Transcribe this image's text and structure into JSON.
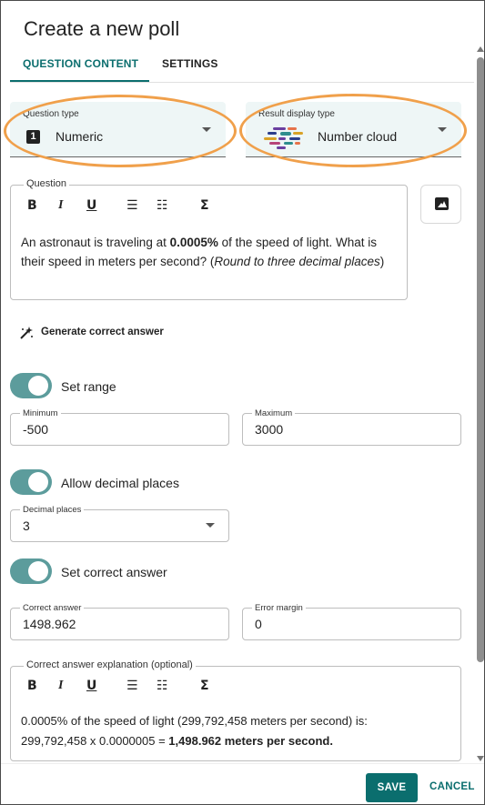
{
  "dialog": {
    "title": "Create a new poll"
  },
  "tabs": [
    {
      "label": "QUESTION CONTENT",
      "active": true
    },
    {
      "label": "SETTINGS",
      "active": false
    }
  ],
  "question_type": {
    "label": "Question type",
    "value": "Numeric",
    "icon": "number-1-icon"
  },
  "result_display": {
    "label": "Result display type",
    "value": "Number cloud",
    "icon": "number-cloud-icon"
  },
  "question": {
    "label": "Question",
    "toolbar": [
      "bold",
      "italic",
      "underline",
      "bulleted-list",
      "numbered-list",
      "equation"
    ],
    "text_pre": "An astronaut is traveling at ",
    "text_bold": "0.0005%",
    "text_mid": " of the speed of light. What is their speed in meters per second? (",
    "text_italic": "Round to three decimal places",
    "text_post": ")"
  },
  "generate_answer": {
    "label": "Generate correct answer"
  },
  "set_range": {
    "label": "Set range",
    "enabled": true
  },
  "minimum": {
    "label": "Minimum",
    "value": "-500"
  },
  "maximum": {
    "label": "Maximum",
    "value": "3000"
  },
  "allow_decimal": {
    "label": "Allow decimal places",
    "enabled": true
  },
  "decimal_places": {
    "label": "Decimal places",
    "value": "3"
  },
  "set_correct": {
    "label": "Set correct answer",
    "enabled": true
  },
  "correct_answer": {
    "label": "Correct answer",
    "value": "1498.962"
  },
  "error_margin": {
    "label": "Error margin",
    "value": "0"
  },
  "explanation": {
    "label": "Correct answer explanation (optional)",
    "line1": "0.0005% of the speed of light (299,792,458 meters per second) is:",
    "line2_pre": "299,792,458 x 0.0000005 = ",
    "line2_bold": "1,498.962 meters per second."
  },
  "actions": {
    "save": "SAVE",
    "cancel": "CANCEL"
  },
  "colors": {
    "accent": "#0b6e6e",
    "toggle": "#5c9c9c",
    "highlight": "#f0a04b",
    "select_bg": "#eef6f6"
  }
}
